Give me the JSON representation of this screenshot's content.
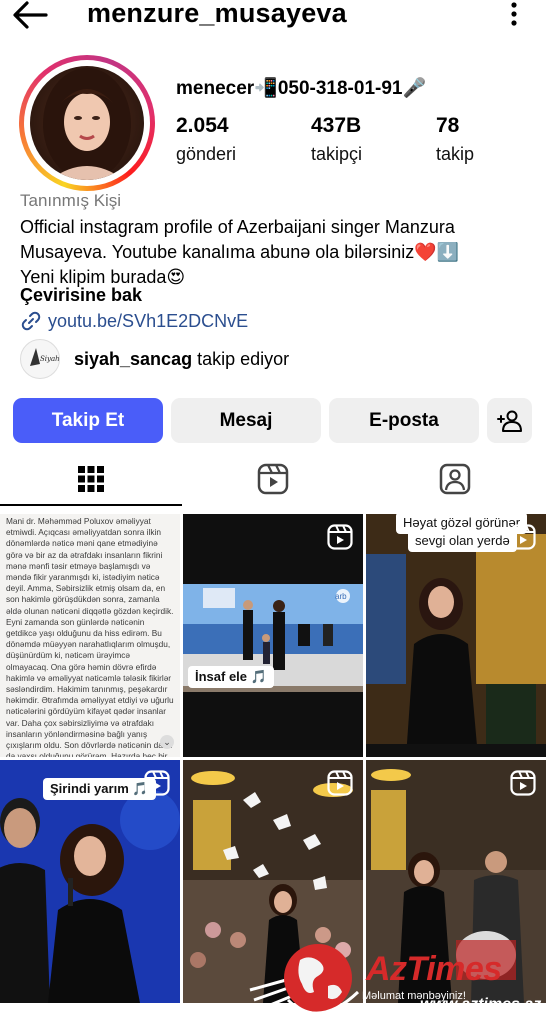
{
  "header": {
    "username": "menzure_musayeva",
    "back_icon": "arrow-left-icon",
    "menu_icon": "more-vertical-icon"
  },
  "profile": {
    "contact_line": "menecer📲050-318-01-91🎤",
    "stats": [
      {
        "value": "2.054",
        "label": "gönderi"
      },
      {
        "value": "437B",
        "label": "takipçi"
      },
      {
        "value": "78",
        "label": "takip"
      }
    ],
    "category": "Tanınmış Kişi",
    "bio_line1": "Official instagram profile of Azerbaijani singer Manzura",
    "bio_line2": "Musayeva. Youtube kanalıma abunə ola bilərsiniz❤️⬇️",
    "bio_line3": "Yeni klipim burada😍",
    "translate": "Çevirisine bak",
    "link": "youtu.be/SVh1E2DCNvE",
    "followed_by_name": "siyah_sancag",
    "followed_by_suffix": " takip ediyor",
    "followed_by_avatar_text": "Siyah SANCAQ"
  },
  "actions": {
    "follow": "Takip Et",
    "message": "Mesaj",
    "email": "E-posta"
  },
  "tabs": [
    "grid-icon",
    "reels-icon",
    "tagged-icon"
  ],
  "posts": {
    "text_post": "Mani dr. Məhəmməd Poluxov əməliyyat etmiwdi. Açıqcası əməliyyatdan sonra ilkin dönəmlərdə nəticə məni qane etmədiyinə görə və bir az da ətrafdakı insanların fikrini mənə mənfi təsir etməyə başlamışdı və məndə fikir yaranmışdı ki, istədiyim nəticə deyil. Amma, Səbirsizlik etmiş olsam da, en son hakimlə görüşdükdən sonra, zamanla əldə olunan nəticəni diqqətlə gözdən keçirdik. Eyni zamanda son günlərdə nəticənin getdikcə yaşı olduğunu da hiss edirəm. Bu dönəmdə müəyyən narahatlıqlarım olmuşdu, düşünürdüm ki, nəticəm ürəyimcə olmayacaq. Ona görə həmin dövrə efirdə hakimlə və əməliyyat nəticəmlə tələsik fikirlər səsləndirdim. Hakimim tanınmış, peşəkardır həkimdir. Ətrafımda əməliyyat etdiyi və uğurlu nəticələrini gördüyüm kifayət qədər insanlar var. Daha çox səbirsizliyimə və ətrafdakı insanların yönləndirməsinə bağlı yanış çıxışlarım oldu. Son dövrlərdə nəticənin daha da yaxşı olduğunu görürəm. Hazırda heç bir narazılığım yoxdur.",
    "caption_insaf": "İnsaf ele 🎵",
    "caption_heyat_1": "Həyat gözəl görünər",
    "caption_heyat_2": "sevgi olan yerdə",
    "caption_sirindi": "Şirindi yarım 🎵",
    "tv_logo": "arb"
  },
  "watermark": {
    "title": "AzTimes",
    "subtitle": "Məlumat mənbəyiniz!",
    "site": "www.aztimes.az"
  }
}
